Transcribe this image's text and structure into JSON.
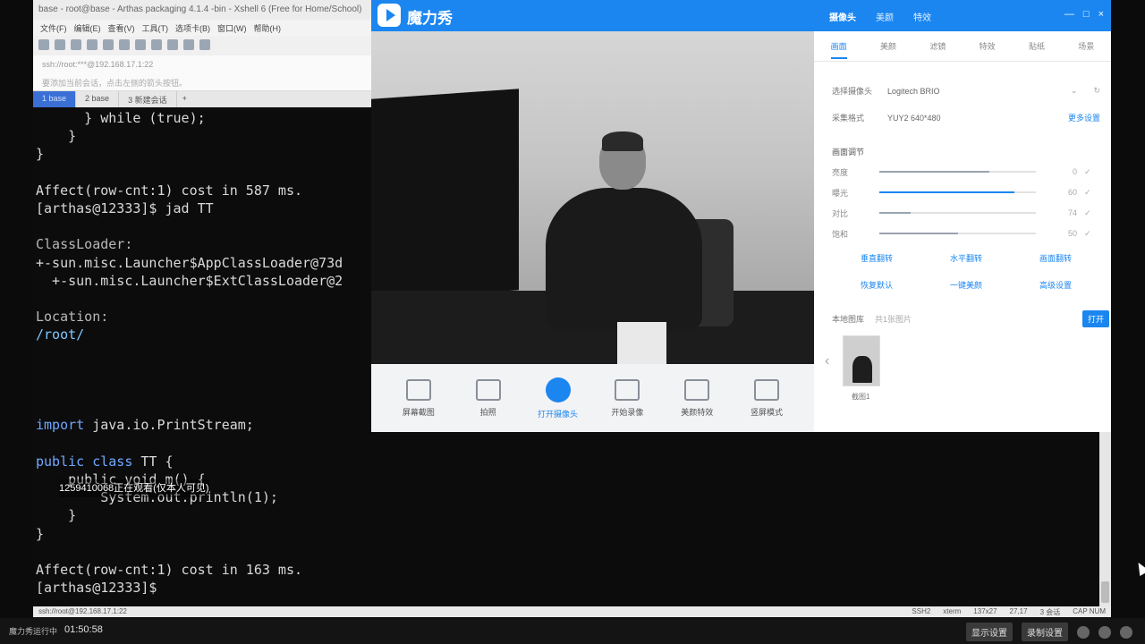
{
  "xshell": {
    "title": "base - root@base - Arthas packaging 4.1.4 -bin - Xshell 6 (Free for Home/School)",
    "menu": [
      "文件(F)",
      "编辑(E)",
      "查看(V)",
      "工具(T)",
      "选项卡(B)",
      "窗口(W)",
      "帮助(H)"
    ],
    "address": "ssh://root:***@192.168.17.1:22",
    "hint": "要添加当前会话，点击左侧的箭头按钮。",
    "tabs": [
      "1 base",
      "2 base",
      "3 新建会话"
    ],
    "tab_add": "+",
    "terminal": {
      "line1": "      } while (true);",
      "line2": "    }",
      "line3": "}",
      "line4": "",
      "line5": "Affect(row-cnt:1) cost in 587 ms.",
      "line6": "[arthas@12333]$ jad TT",
      "line7": "",
      "line8": "ClassLoader:",
      "line9": "+-sun.misc.Launcher$AppClassLoader@73d",
      "line10": "  +-sun.misc.Launcher$ExtClassLoader@2",
      "line11": "",
      "line12": "Location:",
      "line13": "/root/",
      "import_kw": "import",
      "import_rest": " java.io.PrintStream;",
      "class_kw": "public class",
      "class_rest": " TT {",
      "method": "    public void m() {",
      "println": "        System.out.println(1);",
      "close1": "    }",
      "close2": "}",
      "affect2": "Affect(row-cnt:1) cost in 163 ms.",
      "prompt": "[arthas@12333]$ "
    },
    "danmaku": "1259410068正在观看(仅本人可见)",
    "status_left": "ssh://root@192.168.17.1:22",
    "status_right": [
      "SSH2",
      "xterm",
      "137x27",
      "27,17",
      "3 会话",
      "CAP NUM"
    ]
  },
  "camera_app": {
    "app_name": "魔力秀",
    "header_nav": [
      "摄像头",
      "美颜",
      "特效"
    ],
    "header_controls": [
      "—",
      "□",
      "×"
    ],
    "bottom_tools": [
      "屏幕截图",
      "拍照",
      "打开摄像头",
      "开始录像",
      "美颜特效",
      "竖屏模式"
    ],
    "active_tool_index": 2,
    "settings_tabs": [
      "画面",
      "美颜",
      "滤镜",
      "特效",
      "贴纸",
      "场景"
    ],
    "camera_label": "选择摄像头",
    "camera_value": "Logitech BRIO",
    "format_label": "采集格式",
    "format_value": "YUY2 640*480",
    "format_link": "更多设置",
    "image_section": "画面调节",
    "sliders": [
      {
        "label": "亮度",
        "value": 0,
        "level": 0.7
      },
      {
        "label": "曝光",
        "value": 60,
        "level": 0.86
      },
      {
        "label": "对比",
        "value": 74,
        "level": 0.2
      },
      {
        "label": "饱和",
        "value": 50,
        "level": 0.5
      }
    ],
    "mirror_links": [
      "垂直翻转",
      "水平翻转",
      "画面翻转"
    ],
    "reset_links": [
      "恢复默认",
      "一键美颜",
      "高级设置"
    ],
    "recent_label": "本地图库",
    "recent_count": "共1张图片",
    "recent_button": "打开",
    "thumb_label": "截图1",
    "brand_color": "#1b86f0"
  },
  "taskbar": {
    "app_label": "魔力秀运行中",
    "time": "01:50:58",
    "buttons": [
      "显示设置",
      "录制设置"
    ]
  }
}
